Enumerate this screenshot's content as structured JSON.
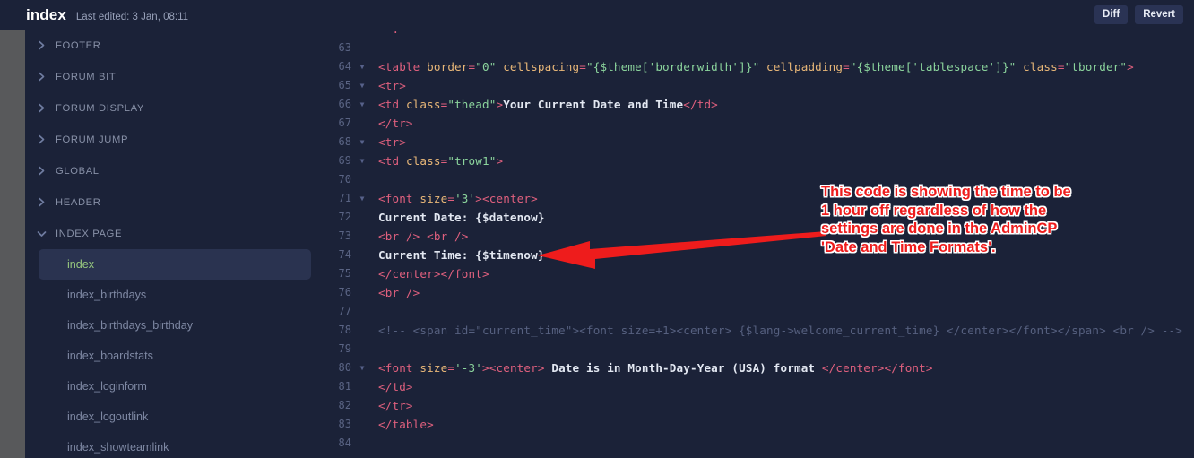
{
  "topbar": {
    "title": "index",
    "last_edited": "Last edited: 3 Jan, 08:11",
    "diff_label": "Diff",
    "revert_label": "Revert"
  },
  "sidebar": {
    "groups": [
      {
        "label": "FOOTER",
        "expanded": false,
        "icon": "chevron-right-icon"
      },
      {
        "label": "FORUM BIT",
        "expanded": false,
        "icon": "chevron-right-icon"
      },
      {
        "label": "FORUM DISPLAY",
        "expanded": false,
        "icon": "chevron-right-icon"
      },
      {
        "label": "FORUM JUMP",
        "expanded": false,
        "icon": "chevron-right-icon"
      },
      {
        "label": "GLOBAL",
        "expanded": false,
        "icon": "chevron-right-icon"
      },
      {
        "label": "HEADER",
        "expanded": false,
        "icon": "chevron-right-icon"
      },
      {
        "label": "INDEX PAGE",
        "expanded": true,
        "icon": "chevron-down-icon"
      }
    ],
    "items": [
      {
        "label": "index",
        "selected": true
      },
      {
        "label": "index_birthdays",
        "selected": false
      },
      {
        "label": "index_birthdays_birthday",
        "selected": false
      },
      {
        "label": "index_boardstats",
        "selected": false
      },
      {
        "label": "index_loginform",
        "selected": false
      },
      {
        "label": "index_logoutlink",
        "selected": false
      },
      {
        "label": "index_showteamlink",
        "selected": false
      }
    ]
  },
  "editor": {
    "lines": [
      {
        "n": "",
        "fold": false,
        "tokens": [
          {
            "c": "t-tag",
            "s": "  ."
          }
        ]
      },
      {
        "n": "63",
        "fold": false,
        "tokens": []
      },
      {
        "n": "64",
        "fold": true,
        "tokens": [
          {
            "c": "t-tag",
            "s": "<table "
          },
          {
            "c": "t-attr",
            "s": "border"
          },
          {
            "c": "t-tag",
            "s": "="
          },
          {
            "c": "t-str",
            "s": "\"0\""
          },
          {
            "c": "t-tag",
            "s": " "
          },
          {
            "c": "t-attr",
            "s": "cellspacing"
          },
          {
            "c": "t-tag",
            "s": "="
          },
          {
            "c": "t-str",
            "s": "\"{$theme['borderwidth']}\""
          },
          {
            "c": "t-tag",
            "s": " "
          },
          {
            "c": "t-attr",
            "s": "cellpadding"
          },
          {
            "c": "t-tag",
            "s": "="
          },
          {
            "c": "t-str",
            "s": "\"{$theme['tablespace']}\""
          },
          {
            "c": "t-tag",
            "s": " "
          },
          {
            "c": "t-attr",
            "s": "class"
          },
          {
            "c": "t-tag",
            "s": "="
          },
          {
            "c": "t-str",
            "s": "\"tborder\""
          },
          {
            "c": "t-tag",
            "s": ">"
          }
        ]
      },
      {
        "n": "65",
        "fold": true,
        "tokens": [
          {
            "c": "t-tag",
            "s": "<tr>"
          }
        ]
      },
      {
        "n": "66",
        "fold": true,
        "tokens": [
          {
            "c": "t-tag",
            "s": "<td "
          },
          {
            "c": "t-attr",
            "s": "class"
          },
          {
            "c": "t-tag",
            "s": "="
          },
          {
            "c": "t-str",
            "s": "\"thead\""
          },
          {
            "c": "t-tag",
            "s": ">"
          },
          {
            "c": "t-txt",
            "s": "Your Current Date and Time"
          },
          {
            "c": "t-tag",
            "s": "</td>"
          }
        ]
      },
      {
        "n": "67",
        "fold": false,
        "tokens": [
          {
            "c": "t-tag",
            "s": "</tr>"
          }
        ]
      },
      {
        "n": "68",
        "fold": true,
        "tokens": [
          {
            "c": "t-tag",
            "s": "<tr>"
          }
        ]
      },
      {
        "n": "69",
        "fold": true,
        "tokens": [
          {
            "c": "t-tag",
            "s": "<td "
          },
          {
            "c": "t-attr",
            "s": "class"
          },
          {
            "c": "t-tag",
            "s": "="
          },
          {
            "c": "t-str",
            "s": "\"trow1\""
          },
          {
            "c": "t-tag",
            "s": ">"
          }
        ]
      },
      {
        "n": "70",
        "fold": false,
        "tokens": []
      },
      {
        "n": "71",
        "fold": true,
        "tokens": [
          {
            "c": "t-tag",
            "s": "<font "
          },
          {
            "c": "t-attr",
            "s": "size"
          },
          {
            "c": "t-tag",
            "s": "="
          },
          {
            "c": "t-str",
            "s": "'3'"
          },
          {
            "c": "t-tag",
            "s": "><center>"
          }
        ]
      },
      {
        "n": "72",
        "fold": false,
        "tokens": [
          {
            "c": "t-txt",
            "s": "Current Date: {$datenow}"
          }
        ]
      },
      {
        "n": "73",
        "fold": false,
        "tokens": [
          {
            "c": "t-tag",
            "s": "<br /> <br />"
          }
        ]
      },
      {
        "n": "74",
        "fold": false,
        "tokens": [
          {
            "c": "t-txt",
            "s": "Current Time: {$timenow}"
          }
        ]
      },
      {
        "n": "75",
        "fold": false,
        "tokens": [
          {
            "c": "t-tag",
            "s": "</center></font>"
          }
        ]
      },
      {
        "n": "76",
        "fold": false,
        "tokens": [
          {
            "c": "t-tag",
            "s": "<br />"
          }
        ]
      },
      {
        "n": "77",
        "fold": false,
        "tokens": []
      },
      {
        "n": "78",
        "fold": false,
        "tokens": [
          {
            "c": "t-cmt",
            "s": "<!-- <span id=\"current_time\"><font size=+1><center> {$lang->welcome_current_time} </center></font></span> <br /> -->"
          }
        ]
      },
      {
        "n": "79",
        "fold": false,
        "tokens": []
      },
      {
        "n": "80",
        "fold": true,
        "tokens": [
          {
            "c": "t-tag",
            "s": "<font "
          },
          {
            "c": "t-attr",
            "s": "size"
          },
          {
            "c": "t-tag",
            "s": "="
          },
          {
            "c": "t-str",
            "s": "'-3'"
          },
          {
            "c": "t-tag",
            "s": "><center> "
          },
          {
            "c": "t-txt",
            "s": "Date is in Month-Day-Year (USA) format "
          },
          {
            "c": "t-tag",
            "s": "</center></font>"
          }
        ]
      },
      {
        "n": "81",
        "fold": false,
        "tokens": [
          {
            "c": "t-tag",
            "s": "</td>"
          }
        ]
      },
      {
        "n": "82",
        "fold": false,
        "tokens": [
          {
            "c": "t-tag",
            "s": "</tr>"
          }
        ]
      },
      {
        "n": "83",
        "fold": false,
        "tokens": [
          {
            "c": "t-tag",
            "s": "</table>"
          }
        ]
      },
      {
        "n": "84",
        "fold": false,
        "tokens": []
      }
    ]
  },
  "annotation": {
    "color": "#ee1c1c",
    "lines": [
      "This code is showing the time to be",
      "1 hour off regardless of how the",
      "settings are done in the AdminCP",
      "'Date and Time Formats'."
    ],
    "arrow": "left-arrow-annotation"
  },
  "colors": {
    "background": "#1b2238",
    "sidebar_selected": "#2a3350",
    "selected_text": "#96c77e",
    "button": "#2a3354",
    "annotation_red": "#ee1c1c",
    "scrollbar": "#58595b"
  }
}
